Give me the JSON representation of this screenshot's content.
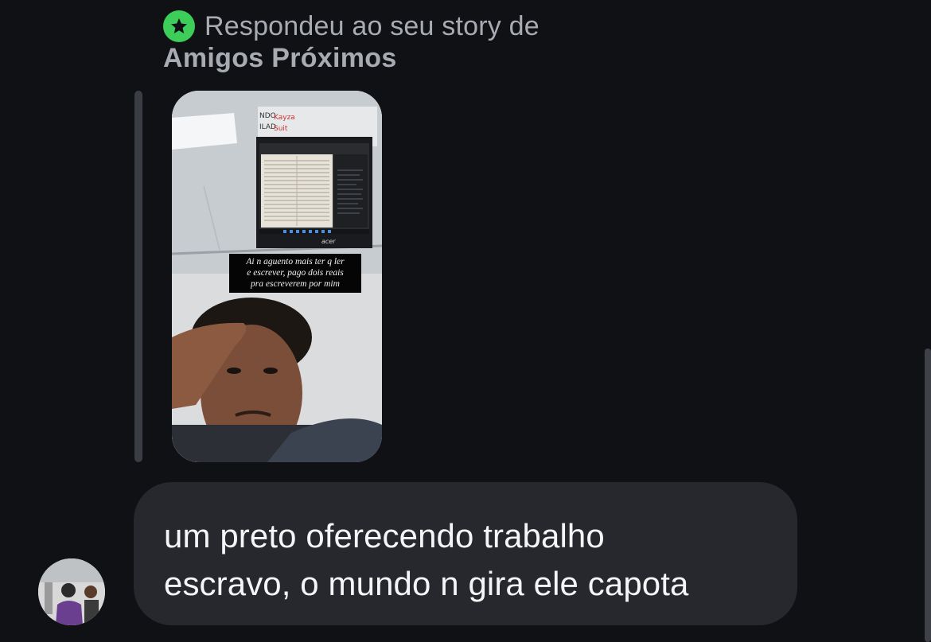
{
  "reply_header": {
    "text": "Respondeu ao seu story de",
    "audience": "Amigos Próximos",
    "badge_icon": "star-icon",
    "badge_color": "#3dce5a"
  },
  "story": {
    "caption": "Ai n aguento mais ter q ler\ne escrever, pago dois reais\npra escreverem por mim",
    "laptop_brand": "acer"
  },
  "message": {
    "text": "um preto oferecendo trabalho\nescravo, o mundo n gira ele capota"
  },
  "colors": {
    "background": "#0f1115",
    "bubble": "#26282d",
    "muted_text": "#a8abb2",
    "message_text": "#f4f5f7"
  }
}
